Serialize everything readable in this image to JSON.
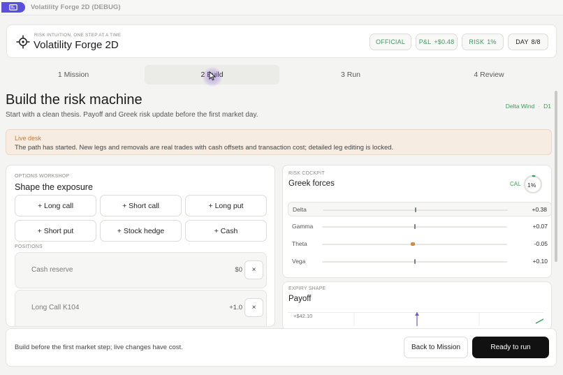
{
  "window": {
    "title": "Volatility Forge 2D (DEBUG)",
    "badge_icon": "window-icon"
  },
  "header": {
    "kicker": "RISK INTUITION, ONE STEP AT A TIME",
    "title": "Volatility Forge 2D",
    "logo_icon": "crosshair-logo-icon",
    "chips": {
      "official": "OFFICIAL",
      "pnl_label": "P&L",
      "pnl_value": "+$0.48",
      "risk_label": "RISK",
      "risk_value": "1%",
      "day_label": "DAY",
      "day_value": "8/8"
    }
  },
  "steps": [
    {
      "label": "1  Mission"
    },
    {
      "label": "2  Build"
    },
    {
      "label": "3  Run"
    },
    {
      "label": "4  Review"
    }
  ],
  "active_step": 1,
  "page": {
    "title": "Build the risk machine",
    "subtitle": "Start with a clean thesis. Payoff and Greek risk update before the first market day.",
    "scenario_name": "Delta Wind",
    "scenario_sep": "·",
    "scenario_code": "D1"
  },
  "notice": {
    "title": "Live desk",
    "text": "The path has started. New legs and removals are real trades with cash offsets and transaction cost; detailed leg editing is locked."
  },
  "workshop": {
    "kicker": "OPTIONS WORKSHOP",
    "title": "Shape the exposure",
    "buttons": [
      "+ Long call",
      "+ Short call",
      "+ Long put",
      "+ Short put",
      "+ Stock hedge",
      "+ Cash"
    ],
    "positions_label": "POSITIONS",
    "positions": [
      {
        "name": "Cash reserve",
        "value": "$0",
        "remove": "×"
      },
      {
        "name": "Long Call  K104",
        "value": "+1.0",
        "remove": "×"
      }
    ]
  },
  "risk": {
    "kicker": "RISK COCKPIT",
    "title": "Greek forces",
    "cal_label": "CAL",
    "gauge_value": "1%",
    "gauge_fraction": 0.01,
    "greeks": [
      {
        "name": "Delta",
        "value": "+0.38",
        "position": 0.5
      },
      {
        "name": "Gamma",
        "value": "+0.07",
        "position": 0.5
      },
      {
        "name": "Theta",
        "value": "-0.05",
        "position": 0.49,
        "warn": true
      },
      {
        "name": "Vega",
        "value": "+0.10",
        "position": 0.5
      }
    ]
  },
  "payoff": {
    "kicker": "EXPIRY SHAPE",
    "title": "Payoff",
    "top_label": "+$42.10"
  },
  "footer": {
    "text": "Build before the first market step; live changes have cost.",
    "back_label": "Back to Mission",
    "run_label": "Ready to run"
  },
  "colors": {
    "accent_green": "#3e9a5e",
    "badge_purple": "#5b4fe0",
    "warn_orange": "#d58a43",
    "primary_button": "#111111"
  }
}
